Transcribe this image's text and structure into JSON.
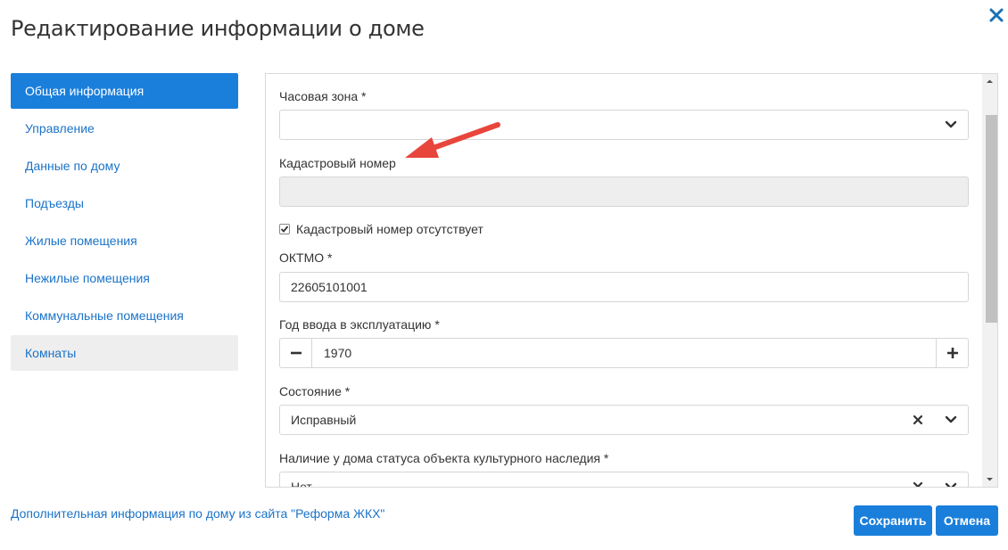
{
  "dialog": {
    "title": "Редактирование информации о доме"
  },
  "sidebar": {
    "items": [
      {
        "label": "Общая информация",
        "state": "active"
      },
      {
        "label": "Управление",
        "state": "normal"
      },
      {
        "label": "Данные по дому",
        "state": "normal"
      },
      {
        "label": "Подъезды",
        "state": "normal"
      },
      {
        "label": "Жилые помещения",
        "state": "normal"
      },
      {
        "label": "Нежилые помещения",
        "state": "normal"
      },
      {
        "label": "Коммунальные помещения",
        "state": "normal"
      },
      {
        "label": "Комнаты",
        "state": "muted"
      }
    ]
  },
  "form": {
    "timezone": {
      "label": "Часовая зона *",
      "value": ""
    },
    "cadastral": {
      "label": "Кадастровый номер",
      "value": ""
    },
    "no_cadastral": {
      "label": "Кадастровый номер отсутствует",
      "checked": true
    },
    "oktmo": {
      "label": "ОКТМО *",
      "value": "22605101001"
    },
    "year": {
      "label": "Год ввода в эксплуатацию *",
      "value": "1970"
    },
    "condition": {
      "label": "Состояние *",
      "value": "Исправный"
    },
    "heritage": {
      "label": "Наличие у дома статуса объекта культурного наследия *",
      "value": "Нет"
    }
  },
  "footer": {
    "link": "Дополнительная информация по дому из сайта \"Реформа ЖКХ\"",
    "save_label": "Сохранить",
    "cancel_label": "Отмена"
  },
  "colors": {
    "accent": "#1a7fdb",
    "link": "#1a73c8",
    "annotation_arrow": "#e8453c"
  },
  "icons": {
    "close": "close-icon",
    "dropdown": "chevron-down-icon",
    "clear": "clear-x-icon",
    "minus": "minus-icon",
    "plus": "plus-icon",
    "check": "checkmark-icon"
  }
}
